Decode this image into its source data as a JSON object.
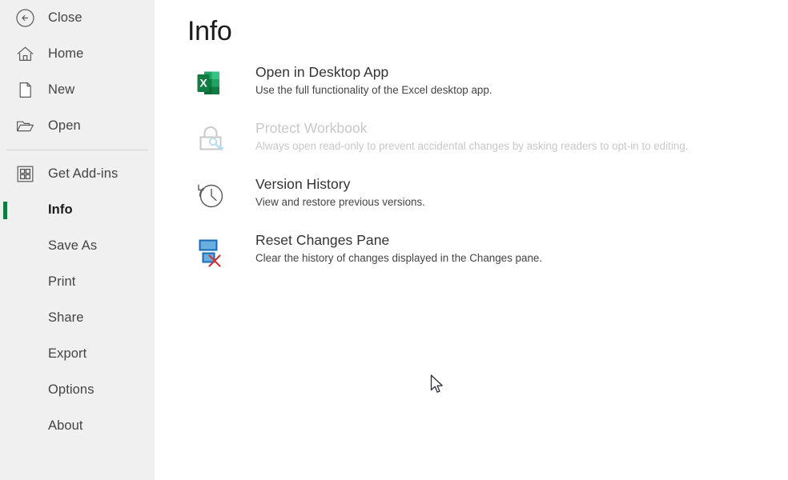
{
  "app": {
    "accent_green": "#107C41",
    "sidebar_bg": "#F0F0F0",
    "content_bg": "#FFFFFF"
  },
  "sidebar": {
    "top_items": [
      {
        "label": "Close",
        "icon": "back-arrow-circle-icon",
        "selected": false
      },
      {
        "label": "Home",
        "icon": "home-icon",
        "selected": false
      },
      {
        "label": "New",
        "icon": "new-document-icon",
        "selected": false
      },
      {
        "label": "Open",
        "icon": "open-folder-icon",
        "selected": false
      }
    ],
    "bottom_items": [
      {
        "label": "Get Add-ins",
        "icon": "add-ins-grid-icon",
        "selected": false
      },
      {
        "label": "Info",
        "icon": "",
        "selected": true
      },
      {
        "label": "Save As",
        "icon": "",
        "selected": false
      },
      {
        "label": "Print",
        "icon": "",
        "selected": false
      },
      {
        "label": "Share",
        "icon": "",
        "selected": false
      },
      {
        "label": "Export",
        "icon": "",
        "selected": false
      },
      {
        "label": "Options",
        "icon": "",
        "selected": false
      },
      {
        "label": "About",
        "icon": "",
        "selected": false
      }
    ]
  },
  "main": {
    "title": "Info",
    "items": [
      {
        "icon": "excel-app-icon",
        "heading": "Open in Desktop App",
        "description": "Use the full functionality of the Excel desktop app.",
        "disabled": false
      },
      {
        "icon": "protect-lock-icon",
        "heading": "Protect Workbook",
        "description": "Always open read-only to prevent accidental changes by asking readers to opt-in to editing.",
        "disabled": true
      },
      {
        "icon": "version-history-clock-icon",
        "heading": "Version History",
        "description": "View and restore previous versions.",
        "disabled": false
      },
      {
        "icon": "reset-changes-pane-icon",
        "heading": "Reset Changes Pane",
        "description": "Clear the history of changes displayed in the Changes pane.",
        "disabled": false
      }
    ]
  }
}
